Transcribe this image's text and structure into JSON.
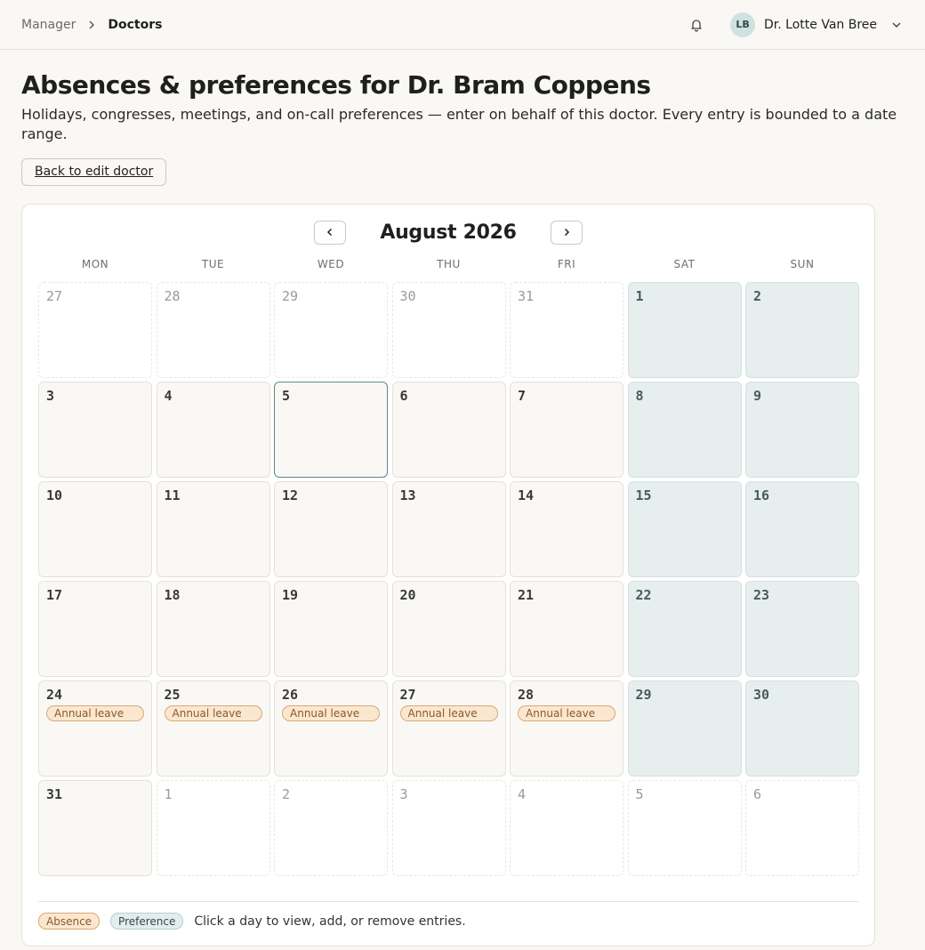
{
  "breadcrumb": {
    "parent": "Manager",
    "current": "Doctors"
  },
  "user": {
    "initials": "LB",
    "name": "Dr. Lotte Van Bree"
  },
  "page": {
    "title": "Absences & preferences for Dr. Bram Coppens",
    "subtitle": "Holidays, congresses, meetings, and on-call preferences — enter on behalf of this doctor. Every entry is bounded to a date range.",
    "back_label": "Back to edit doctor"
  },
  "calendar": {
    "month_label": "August 2026",
    "weekdays": [
      "MON",
      "TUE",
      "WED",
      "THU",
      "FRI",
      "SAT",
      "SUN"
    ],
    "days": [
      {
        "n": "27",
        "type": "out"
      },
      {
        "n": "28",
        "type": "out"
      },
      {
        "n": "29",
        "type": "out"
      },
      {
        "n": "30",
        "type": "out"
      },
      {
        "n": "31",
        "type": "out"
      },
      {
        "n": "1",
        "type": "weekend"
      },
      {
        "n": "2",
        "type": "weekend"
      },
      {
        "n": "3",
        "type": "in"
      },
      {
        "n": "4",
        "type": "in"
      },
      {
        "n": "5",
        "type": "today"
      },
      {
        "n": "6",
        "type": "in"
      },
      {
        "n": "7",
        "type": "in"
      },
      {
        "n": "8",
        "type": "weekend"
      },
      {
        "n": "9",
        "type": "weekend"
      },
      {
        "n": "10",
        "type": "in"
      },
      {
        "n": "11",
        "type": "in"
      },
      {
        "n": "12",
        "type": "in"
      },
      {
        "n": "13",
        "type": "in"
      },
      {
        "n": "14",
        "type": "in"
      },
      {
        "n": "15",
        "type": "weekend"
      },
      {
        "n": "16",
        "type": "weekend"
      },
      {
        "n": "17",
        "type": "in"
      },
      {
        "n": "18",
        "type": "in"
      },
      {
        "n": "19",
        "type": "in"
      },
      {
        "n": "20",
        "type": "in"
      },
      {
        "n": "21",
        "type": "in"
      },
      {
        "n": "22",
        "type": "weekend"
      },
      {
        "n": "23",
        "type": "weekend"
      },
      {
        "n": "24",
        "type": "in",
        "entry": "Annual leave"
      },
      {
        "n": "25",
        "type": "in",
        "entry": "Annual leave"
      },
      {
        "n": "26",
        "type": "in",
        "entry": "Annual leave"
      },
      {
        "n": "27",
        "type": "in",
        "entry": "Annual leave"
      },
      {
        "n": "28",
        "type": "in",
        "entry": "Annual leave"
      },
      {
        "n": "29",
        "type": "weekend"
      },
      {
        "n": "30",
        "type": "weekend"
      },
      {
        "n": "31",
        "type": "in"
      },
      {
        "n": "1",
        "type": "out"
      },
      {
        "n": "2",
        "type": "out"
      },
      {
        "n": "3",
        "type": "out"
      },
      {
        "n": "4",
        "type": "out"
      },
      {
        "n": "5",
        "type": "out"
      },
      {
        "n": "6",
        "type": "out"
      }
    ]
  },
  "legend": {
    "absence": "Absence",
    "preference": "Preference",
    "hint": "Click a day to view, add, or remove entries."
  },
  "colors": {
    "accent": "#5c8a8e",
    "absence_bg": "#fbe7cf",
    "preference_bg": "#e2eded",
    "weekend_bg": "#e6eeee"
  }
}
